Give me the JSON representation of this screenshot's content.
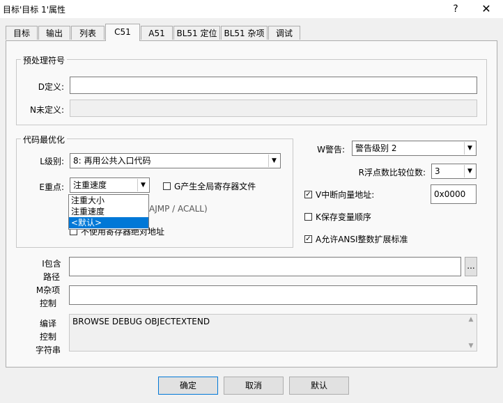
{
  "window": {
    "title": "目标'目标 1'属性",
    "help": "?",
    "close": "✕"
  },
  "tabs": [
    {
      "label": "目标"
    },
    {
      "label": "输出"
    },
    {
      "label": "列表"
    },
    {
      "label": "C51"
    },
    {
      "label": "A51"
    },
    {
      "label": "BL51 定位"
    },
    {
      "label": "BL51 杂项"
    },
    {
      "label": "调试"
    }
  ],
  "active_tab": "C51",
  "preprocessor": {
    "group_title": "预处理符号",
    "define_label": "D定义:",
    "define_value": "",
    "undefine_label": "N未定义:",
    "undefine_value": ""
  },
  "optimization": {
    "group_title": "代码最优化",
    "level_label": "L级别:",
    "level_value": "8: 再用公共入口代码",
    "emphasis_label": "E重点:",
    "emphasis_value": "注重速度",
    "emphasis_options": [
      "注重大小",
      "注重速度",
      "<默认>"
    ],
    "global_reg_label": "G产生全局寄存器文件",
    "global_reg_checked": false,
    "ajmp_partial": "AJMP / ACALL)",
    "abs_reg_partial": "不使用寄存器绝对地址",
    "abs_reg_checked": false
  },
  "warnings": {
    "warn_label": "W警告:",
    "warn_value": "警告级别 2",
    "float_label": "R浮点数比较位数:",
    "float_value": "3",
    "vector_label": "V中断向量地址:",
    "vector_checked": true,
    "vector_value": "0x0000",
    "keep_vars_label": "K保存变量顺序",
    "keep_vars_checked": false,
    "ansi_label": "A允许ANSI整数扩展标准",
    "ansi_checked": true
  },
  "paths": {
    "include_label_1": "I包含",
    "include_label_2": "路径",
    "include_value": "",
    "browse": "...",
    "misc_label_1": "M杂项",
    "misc_label_2": "控制",
    "misc_value": "",
    "compile_label_1": "编译",
    "compile_label_2": "控制",
    "compile_label_3": "字符串",
    "compile_value": "BROWSE DEBUG OBJECTEXTEND"
  },
  "buttons": {
    "ok": "确定",
    "cancel": "取消",
    "defaults": "默认"
  },
  "colors": {
    "accent": "#0078d7",
    "dialog_bg": "#f0f0f0",
    "panel_bg": "#f9f9f9"
  }
}
